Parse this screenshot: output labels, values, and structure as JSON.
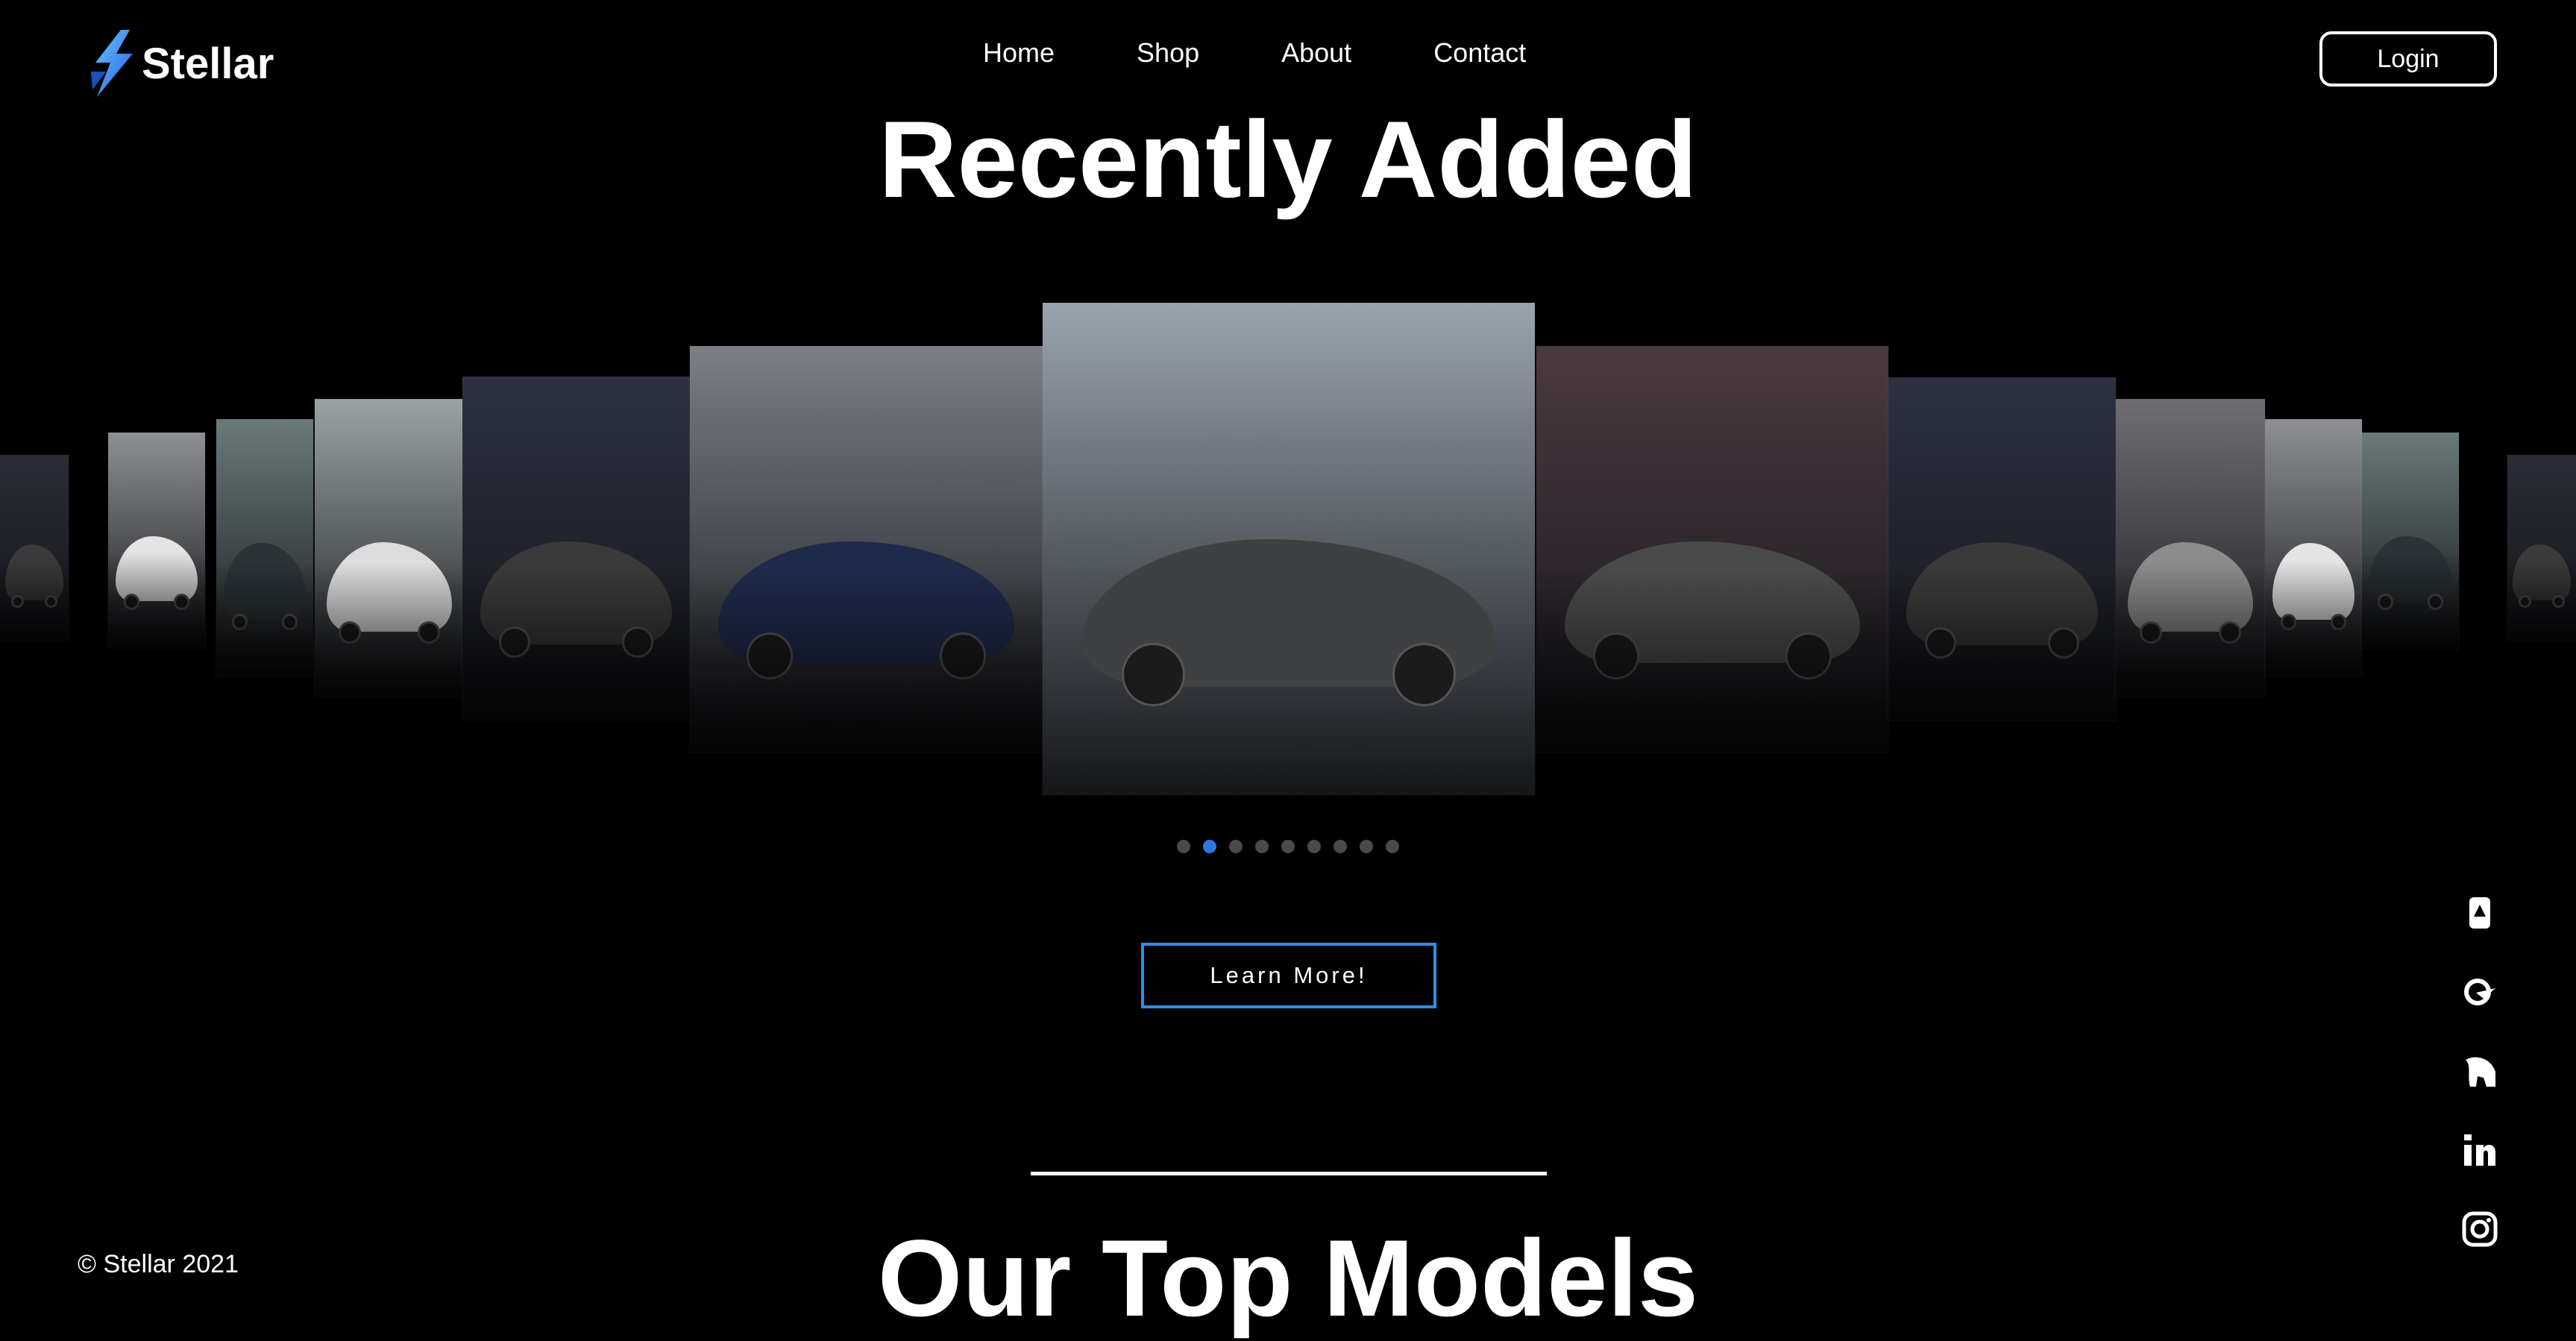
{
  "brand": {
    "name": "Stellar",
    "logo_icon": "lightning-bolt-icon",
    "accent": "#2f8ee8"
  },
  "nav": {
    "items": [
      "Home",
      "Shop",
      "About",
      "Contact"
    ],
    "login_label": "Login"
  },
  "recently_added": {
    "title": "Recently Added",
    "slides": [
      {
        "label": "Grey Porsche 911 in tunnel",
        "bg": "#2a2d36",
        "car": "#3b3b3b"
      },
      {
        "label": "White Tesla Model 3",
        "bg": "#8e9094",
        "car": "#e4e4e4"
      },
      {
        "label": "Bugatti Divo on road",
        "bg": "#6b7a7a",
        "car": "#2b3337"
      },
      {
        "label": "White Jaguar F-Type",
        "bg": "#9aa3a4",
        "car": "#dcdcdc"
      },
      {
        "label": "Porsche 911 in tunnel",
        "bg": "#2d3140",
        "car": "#3a3a3a"
      },
      {
        "label": "Blue Tesla Model 3 at sunset",
        "bg": "#7b7f86",
        "car": "#1d2a4a"
      },
      {
        "label": "Tesla Roadster on hill road",
        "bg": "#9aa3ac",
        "car": "#3f4042"
      },
      {
        "label": "Porsche 911 Carrera in parking garage",
        "bg": "#4a3a40",
        "car": "#4a4a4a"
      },
      {
        "label": "Porsche 911 in tunnel",
        "bg": "#2d3140",
        "car": "#3a3a3a"
      },
      {
        "label": "Silver Porsche 911 on street",
        "bg": "#6f6f73",
        "car": "#8c8c8c"
      },
      {
        "label": "White Tesla Model 3",
        "bg": "#8e9094",
        "car": "#e4e4e4"
      },
      {
        "label": "Bugatti Divo on road",
        "bg": "#6b7a7a",
        "car": "#2b3337"
      },
      {
        "label": "Grey Porsche 911 in tunnel",
        "bg": "#2a2d36",
        "car": "#3b3b3b"
      }
    ],
    "dots": {
      "count": 9,
      "active_index": 1
    },
    "cta_label": "Learn More!"
  },
  "top_models": {
    "title": "Our Top Models"
  },
  "footer": {
    "copyright": "© Stellar 2021"
  },
  "social": [
    "linktree-icon",
    "qzone-icon",
    "spartan-helmet-icon",
    "linkedin-icon",
    "instagram-icon"
  ]
}
